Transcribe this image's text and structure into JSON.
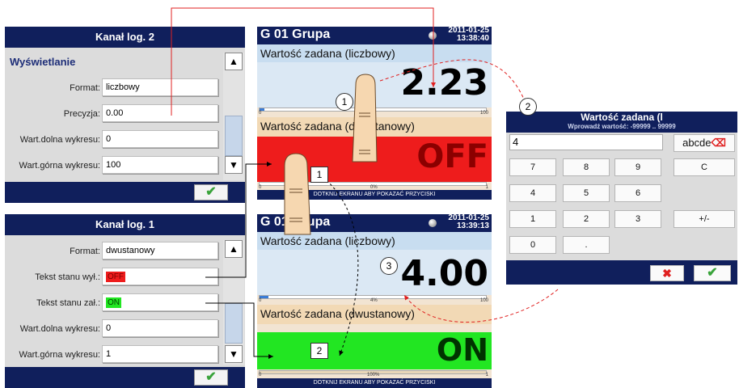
{
  "colors": {
    "header": "#101f5c",
    "red": "#ee1c1c",
    "green": "#22e622",
    "accent_red": "#ff0000"
  },
  "panel_top": {
    "title": "Kanał log. 2",
    "section": "Wyświetlanie",
    "fields": [
      {
        "label": "Format:",
        "value": "liczbowy"
      },
      {
        "label": "Precyzja:",
        "value": "0.00"
      },
      {
        "label": "Wart.dolna wykresu:",
        "value": "0"
      },
      {
        "label": "Wart.górna wykresu:",
        "value": "100"
      }
    ],
    "scroll_up": "▲",
    "scroll_down": "▼",
    "ok": "✔"
  },
  "panel_bottom": {
    "title": "Kanał log. 1",
    "fields": [
      {
        "label": "Format:",
        "value": "dwustanowy"
      },
      {
        "label": "Tekst stanu wył.:",
        "value": "OFF"
      },
      {
        "label": "Tekst stanu zał.:",
        "value": "ON"
      },
      {
        "label": "Wart.dolna wykresu:",
        "value": "0"
      },
      {
        "label": "Wart.górna wykresu:",
        "value": "1"
      }
    ],
    "scroll_up": "▲",
    "scroll_down": "▼",
    "ok": "✔"
  },
  "screen_top": {
    "title": "G 01  Grupa",
    "date": "2011-01-25",
    "time": "13:38:40",
    "ch1_name": "Wartość zadana (liczbowy)",
    "ch1_value": "2.23",
    "ch1_min": "0",
    "ch1_max": "100",
    "ch1_fill": 0.022,
    "ch2_name": "Wartość zadana (dwustanowy)",
    "ch2_value": "OFF",
    "ch2_min": "0",
    "ch2_pct": "0%",
    "ch2_max": "1",
    "footer": "DOTKNIJ EKRANU ABY POKAZAĆ PRZYCISKI"
  },
  "screen_bottom": {
    "title": "G 01  Grupa",
    "date": "2011-01-25",
    "time": "13:39:13",
    "ch1_name": "Wartość zadana (liczbowy)",
    "ch1_value": "4.00",
    "ch1_min": "0",
    "ch1_pct": "4%",
    "ch1_max": "100",
    "ch1_fill": 0.04,
    "ch2_name": "Wartość zadana (dwustanowy)",
    "ch2_value": "ON",
    "ch2_min": "0",
    "ch2_pct": "100%",
    "ch2_max": "1",
    "ch2_fill": 1.0,
    "footer": "DOTKNIJ EKRANU ABY POKAZAĆ PRZYCISKI"
  },
  "keypad": {
    "title": "Wartość zadana (l",
    "subtitle": "Wprowadź wartość: -99999 .. 99999",
    "input": "4",
    "abc": "abcde",
    "keys": [
      "7",
      "8",
      "9",
      "C",
      "4",
      "5",
      "6",
      "1",
      "2",
      "3",
      "+/-",
      "0",
      "."
    ],
    "cancel": "✖",
    "ok": "✔"
  },
  "callouts": {
    "c1": "1",
    "c2": "2",
    "c3": "3",
    "b1": "1",
    "b2": "2"
  }
}
